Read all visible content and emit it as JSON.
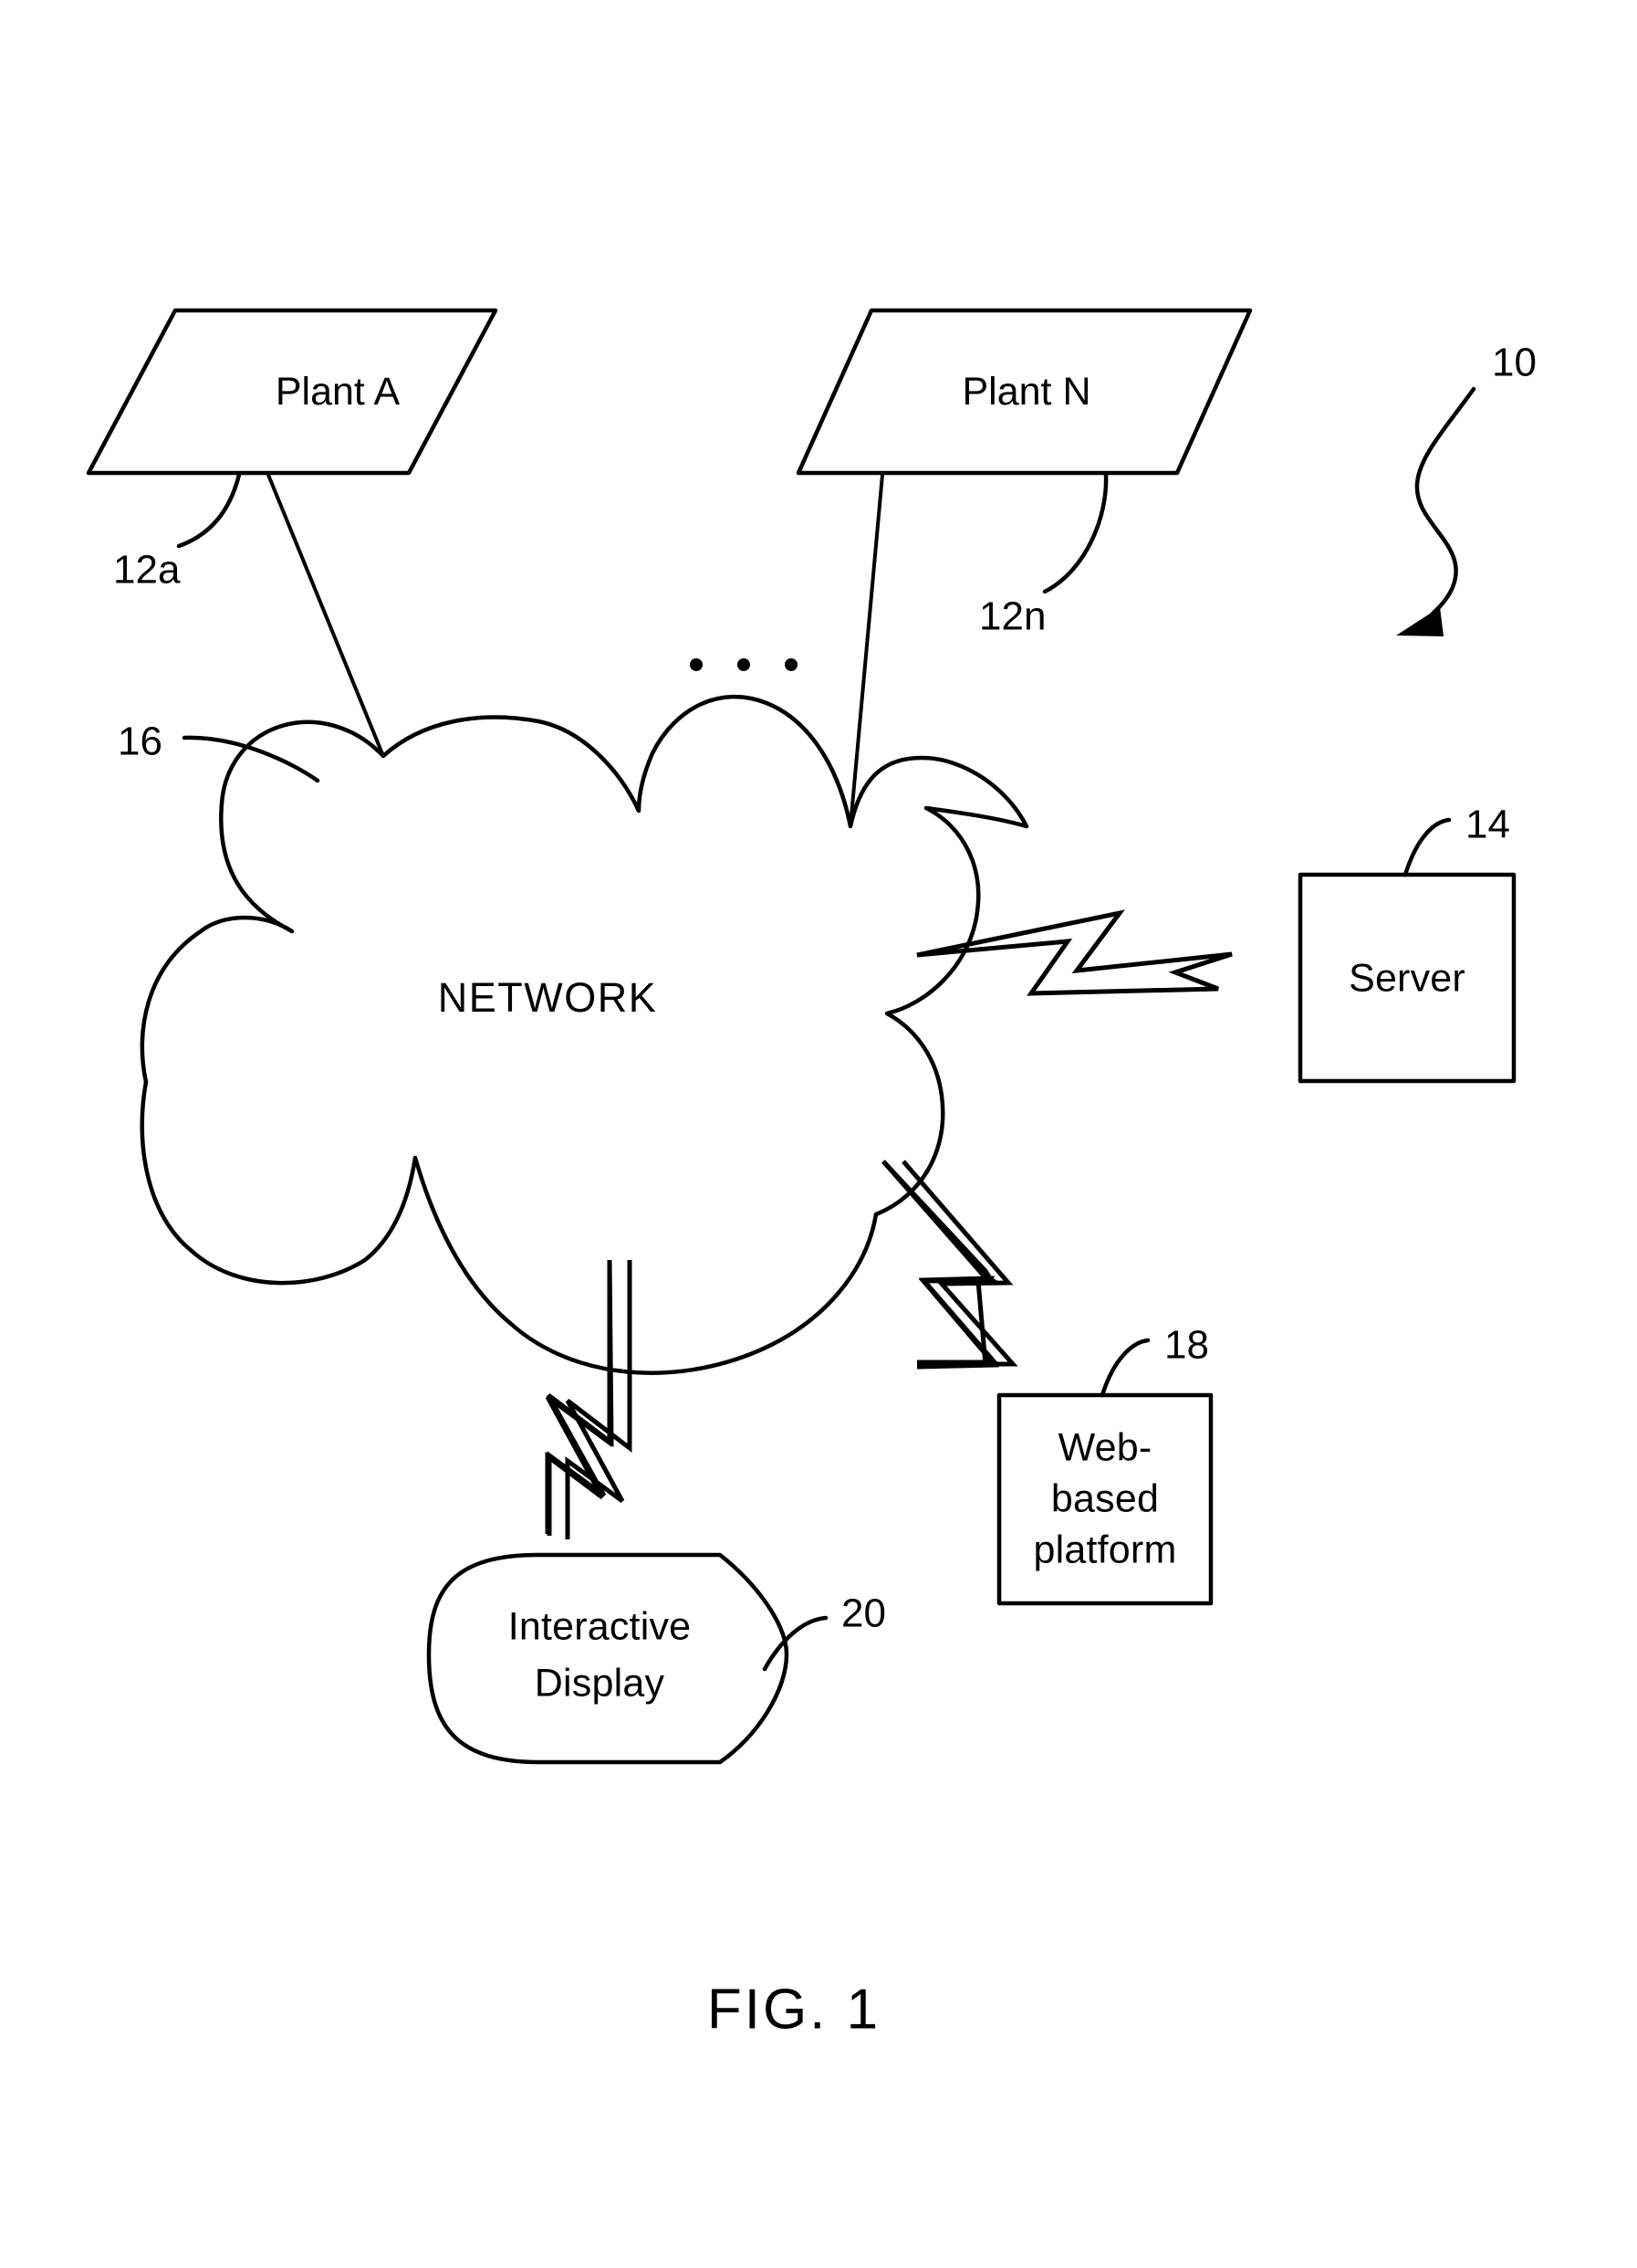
{
  "figure": {
    "caption": "FIG. 1",
    "system_reference": "10"
  },
  "nodes": {
    "plant_a": {
      "label": "Plant A",
      "reference": "12a",
      "shape": "parallelogram"
    },
    "plant_n": {
      "label": "Plant N",
      "reference": "12n",
      "shape": "parallelogram"
    },
    "network": {
      "label": "NETWORK",
      "reference": "16",
      "shape": "cloud"
    },
    "server": {
      "label": "Server",
      "reference": "14",
      "shape": "rectangle"
    },
    "web_platform": {
      "label_line1": "Web-",
      "label_line2": "based",
      "label_line3": "platform",
      "reference": "18",
      "shape": "rectangle"
    },
    "interactive_display": {
      "label_line1": "Interactive",
      "label_line2": "Display",
      "reference": "20",
      "shape": "rounded-terminal"
    }
  },
  "ellipsis": {
    "text": "• • •",
    "meaning": "additional plants between Plant A and Plant N"
  },
  "connections": [
    {
      "from": "plant_a",
      "to": "network",
      "style": "solid-line"
    },
    {
      "from": "plant_n",
      "to": "network",
      "style": "solid-line"
    },
    {
      "from": "network",
      "to": "server",
      "style": "lightning-bolt"
    },
    {
      "from": "network",
      "to": "web_platform",
      "style": "lightning-bolt"
    },
    {
      "from": "network",
      "to": "interactive_display",
      "style": "lightning-bolt"
    }
  ],
  "colors": {
    "line": "#000000",
    "background": "#ffffff",
    "text": "#000000"
  }
}
